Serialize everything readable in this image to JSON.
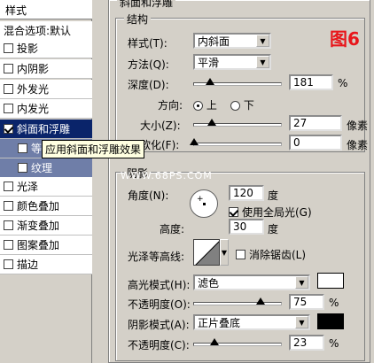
{
  "left_panel": {
    "header": "样式",
    "blend_options": "混合选项:默认",
    "items": [
      {
        "label": "投影",
        "checked": false
      },
      {
        "label": "内阴影",
        "checked": false
      },
      {
        "label": "外发光",
        "checked": false
      },
      {
        "label": "内发光",
        "checked": false
      },
      {
        "label": "斜面和浮雕",
        "checked": true,
        "selected": true
      },
      {
        "label": "等",
        "checked": false,
        "sub": true
      },
      {
        "label": "纹理",
        "checked": false,
        "sub": true
      },
      {
        "label": "光泽",
        "checked": false
      },
      {
        "label": "颜色叠加",
        "checked": false
      },
      {
        "label": "渐变叠加",
        "checked": false
      },
      {
        "label": "图案叠加",
        "checked": false
      },
      {
        "label": "描边",
        "checked": false
      }
    ],
    "tooltip": "应用斜面和浮雕效果"
  },
  "bevel": {
    "group_title": "斜面和浮雕",
    "structure_title": "结构",
    "figure_label": "图6",
    "style_label": "样式(T):",
    "style_value": "内斜面",
    "method_label": "方法(Q):",
    "method_value": "平滑",
    "depth_label": "深度(D):",
    "depth_value": "181",
    "depth_fraction": 0.18,
    "depth_unit": "%",
    "direction_label": "方向:",
    "direction_up": "上",
    "direction_down": "下",
    "direction_selected": "up",
    "size_label": "大小(Z):",
    "size_value": "27",
    "size_unit": "像素",
    "size_fraction": 0.2,
    "soften_label": "软化(F):",
    "soften_value": "0",
    "soften_unit": "像素",
    "soften_fraction": 0.0
  },
  "shading": {
    "title": "阴影",
    "watermark": "WWW.68PS.COM",
    "angle_label": "角度(N):",
    "angle_value": "120",
    "angle_unit": "度",
    "global_light_label": "使用全局光(G)",
    "global_light_checked": true,
    "altitude_label": "高度:",
    "altitude_value": "30",
    "altitude_unit": "度",
    "gloss_label": "光泽等高线:",
    "anti_alias_label": "消除锯齿(L)",
    "anti_alias_checked": false,
    "highlight_mode_label": "高光模式(H):",
    "highlight_mode_value": "滤色",
    "highlight_color": "#ffffff",
    "highlight_opacity_label": "不透明度(O):",
    "highlight_opacity_value": "75",
    "highlight_opacity_fraction": 0.75,
    "shadow_mode_label": "阴影模式(A):",
    "shadow_mode_value": "正片叠底",
    "shadow_color": "#000000",
    "shadow_opacity_label": "不透明度(C):",
    "shadow_opacity_value": "23",
    "shadow_opacity_fraction": 0.23,
    "percent_unit": "%"
  }
}
